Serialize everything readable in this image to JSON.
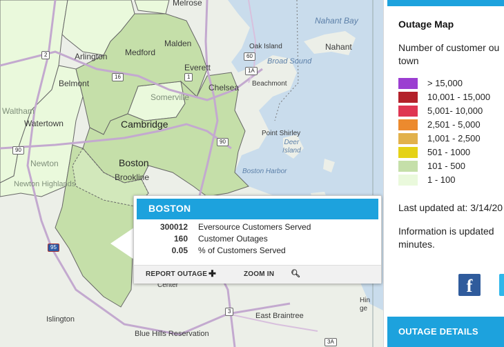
{
  "map": {
    "places": {
      "melrose": "Melrose",
      "nahant_bay": "Nahant Bay",
      "arlington": "Arlington",
      "medford": "Medford",
      "malden": "Malden",
      "oak_island": "Oak Island",
      "nahant": "Nahant",
      "broad_sound": "Broad Sound",
      "everett": "Everett",
      "belmont": "Belmont",
      "chelsea": "Chelsea",
      "beachmont": "Beachmont",
      "somerville": "Somerville",
      "waltham": "Waltham",
      "watertown": "Watertown",
      "cambridge": "Cambridge",
      "point_shirley": "Point Shirley",
      "deer_island": "Deer\nIsland",
      "newton": "Newton",
      "boston": "Boston",
      "brookline": "Brookline",
      "boston_harbor": "Boston Harbor",
      "newton_highlands": "Newton Highlands",
      "islington": "Islington",
      "east_braintree": "East Braintree",
      "blue_hills": "Blue Hills Reservation",
      "hingham": "Hin\nge",
      "center": "Center"
    },
    "shields": {
      "r2": "2",
      "r60": "60",
      "r1a": "1A",
      "r16": "16",
      "r1": "1",
      "r90a": "90",
      "r90b": "90",
      "r95": "95",
      "r3": "3",
      "r3a": "3A"
    }
  },
  "popup": {
    "title": "BOSTON",
    "stats": [
      {
        "value": "300012",
        "label": "Eversource Customers Served"
      },
      {
        "value": "160",
        "label": "Customer Outages"
      },
      {
        "value": "0.05",
        "label": "% of Customers Served"
      }
    ],
    "report_label": "REPORT OUTAGE",
    "report_icon": "plus-icon",
    "zoom_label": "ZOOM IN",
    "zoom_icon": "magnifier-icon"
  },
  "panel": {
    "title": "Outage Map",
    "desc_line1": "Number of customer ou",
    "desc_line2": "town",
    "legend": [
      {
        "label": "> 15,000",
        "color": "#9b3ed1"
      },
      {
        "label": "10,001 - 15,000",
        "color": "#b3212a"
      },
      {
        "label": "5,001- 10,000",
        "color": "#df3653"
      },
      {
        "label": "2,501 - 5,000",
        "color": "#ec8a2e"
      },
      {
        "label": "1,001 - 2,500",
        "color": "#e2b14b"
      },
      {
        "label": "501 - 1000",
        "color": "#e5d216"
      },
      {
        "label": "101 - 500",
        "color": "#c5dfa9"
      },
      {
        "label": "1 - 100",
        "color": "#eaf9dc"
      }
    ],
    "updated": "Last updated at: 3/14/20",
    "info_line1": "Information is updated",
    "info_line2": "minutes.",
    "facebook_icon": "facebook-icon",
    "facebook_glyph": "f",
    "twitter_icon": "twitter-icon",
    "details_label": "OUTAGE DETAILS"
  },
  "colors": {
    "accent": "#1da2dd",
    "town_light": "#eaf9dc",
    "town_medium": "#c5dfa9"
  }
}
